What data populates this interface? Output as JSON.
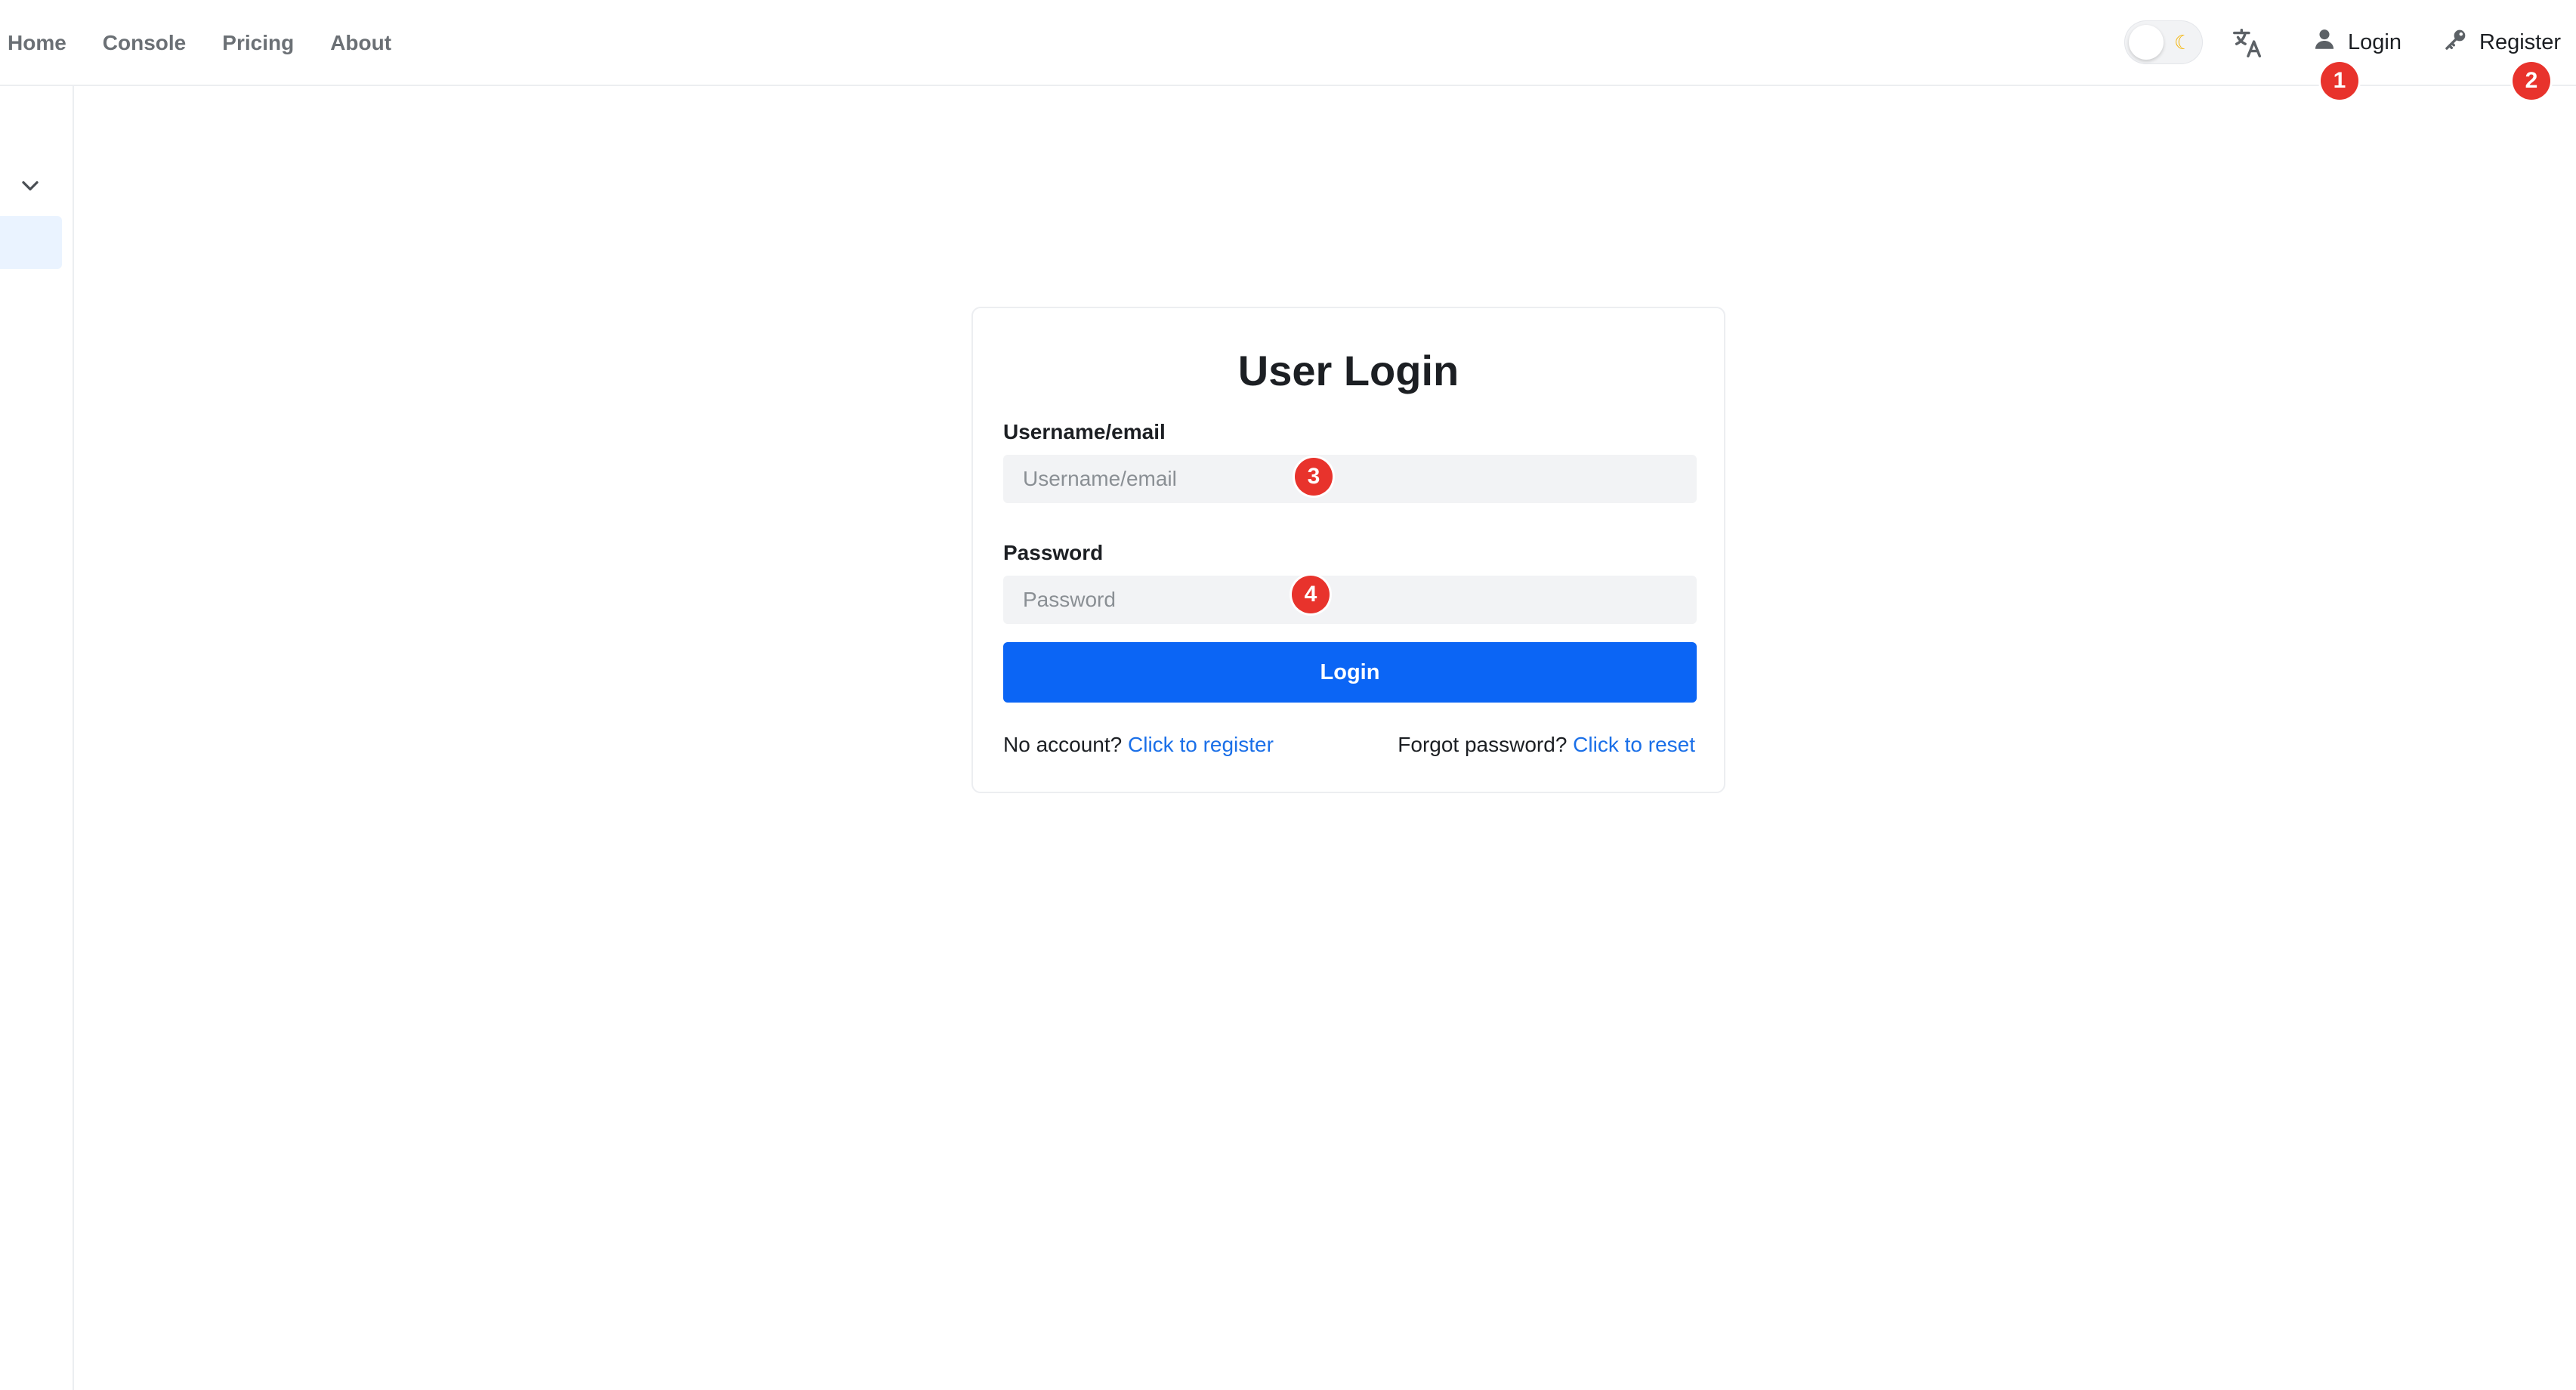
{
  "nav": {
    "items": [
      {
        "label": "Home"
      },
      {
        "label": "Console"
      },
      {
        "label": "Pricing"
      },
      {
        "label": "About"
      }
    ]
  },
  "header": {
    "theme_toggle": {
      "state": "light",
      "icon": "moon-icon"
    },
    "translate_icon": "translate-icon",
    "login": {
      "label": "Login",
      "icon": "user-icon"
    },
    "register": {
      "label": "Register",
      "icon": "key-icon"
    }
  },
  "sidebar": {
    "collapse_icon": "chevron-down-icon"
  },
  "login_card": {
    "title": "User Login",
    "username": {
      "label": "Username/email",
      "placeholder": "Username/email",
      "value": ""
    },
    "password": {
      "label": "Password",
      "placeholder": "Password",
      "value": ""
    },
    "submit_label": "Login",
    "register_prompt": "No account?",
    "register_link": "Click to register",
    "reset_prompt": "Forgot password?",
    "reset_link": "Click to reset"
  },
  "markers": [
    "1",
    "2",
    "3",
    "4"
  ],
  "colors": {
    "primary": "#0b65f5",
    "link": "#1a6fe8",
    "marker": "#e8332c",
    "sidebar_active": "#eaf3ff",
    "input_bg": "#f2f3f5"
  }
}
